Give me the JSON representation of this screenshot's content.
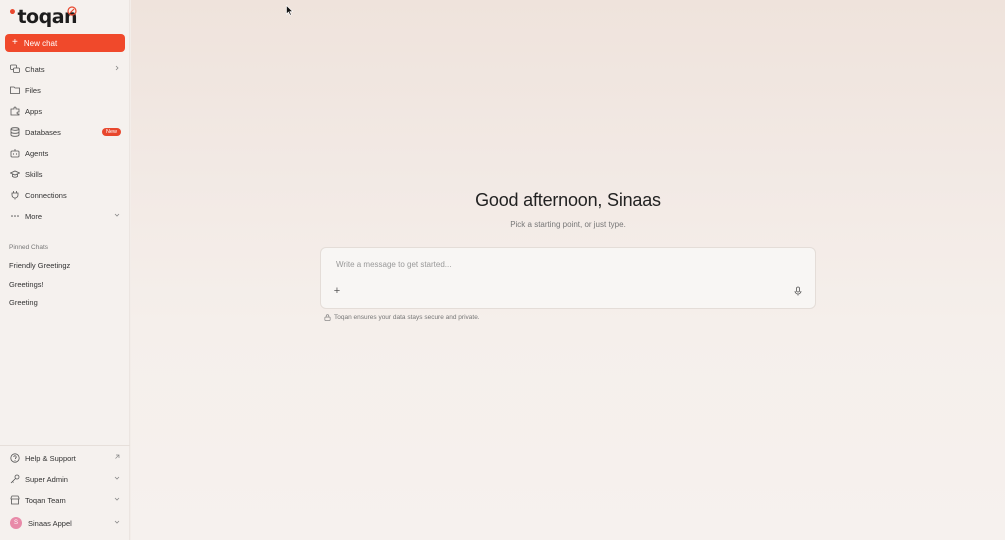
{
  "app": {
    "logo_text": "toqan"
  },
  "sidebar": {
    "new_chat_label": "New chat",
    "items": [
      {
        "label": "Chats",
        "icon": "chat-bubbles-icon"
      },
      {
        "label": "Files",
        "icon": "folder-icon"
      },
      {
        "label": "Apps",
        "icon": "puzzle-icon"
      },
      {
        "label": "Databases",
        "icon": "database-icon",
        "badge": "New"
      },
      {
        "label": "Agents",
        "icon": "robot-icon"
      },
      {
        "label": "Skills",
        "icon": "graduation-cap-icon"
      },
      {
        "label": "Connections",
        "icon": "plug-icon"
      },
      {
        "label": "More",
        "icon": "more-dots-icon"
      }
    ],
    "pinned_label": "Pinned Chats",
    "pinned": [
      "Friendly Greetingz",
      "Greetings!",
      "Greeting"
    ],
    "bottom": [
      {
        "label": "Help & Support",
        "icon": "help-icon"
      },
      {
        "label": "Super Admin",
        "icon": "key-icon"
      },
      {
        "label": "Toqan Team",
        "icon": "store-icon"
      }
    ],
    "user": {
      "name": "Sinaas Appel",
      "initial": "S"
    }
  },
  "main": {
    "greeting": "Good afternoon, Sinaas",
    "subtitle": "Pick a starting point, or just type.",
    "composer_placeholder": "Write a message to get started...",
    "attach_label": "+",
    "privacy_note": "Toqan ensures your data stays secure and private."
  },
  "colors": {
    "accent": "#f0492b",
    "avatar": "#e88aa8"
  }
}
